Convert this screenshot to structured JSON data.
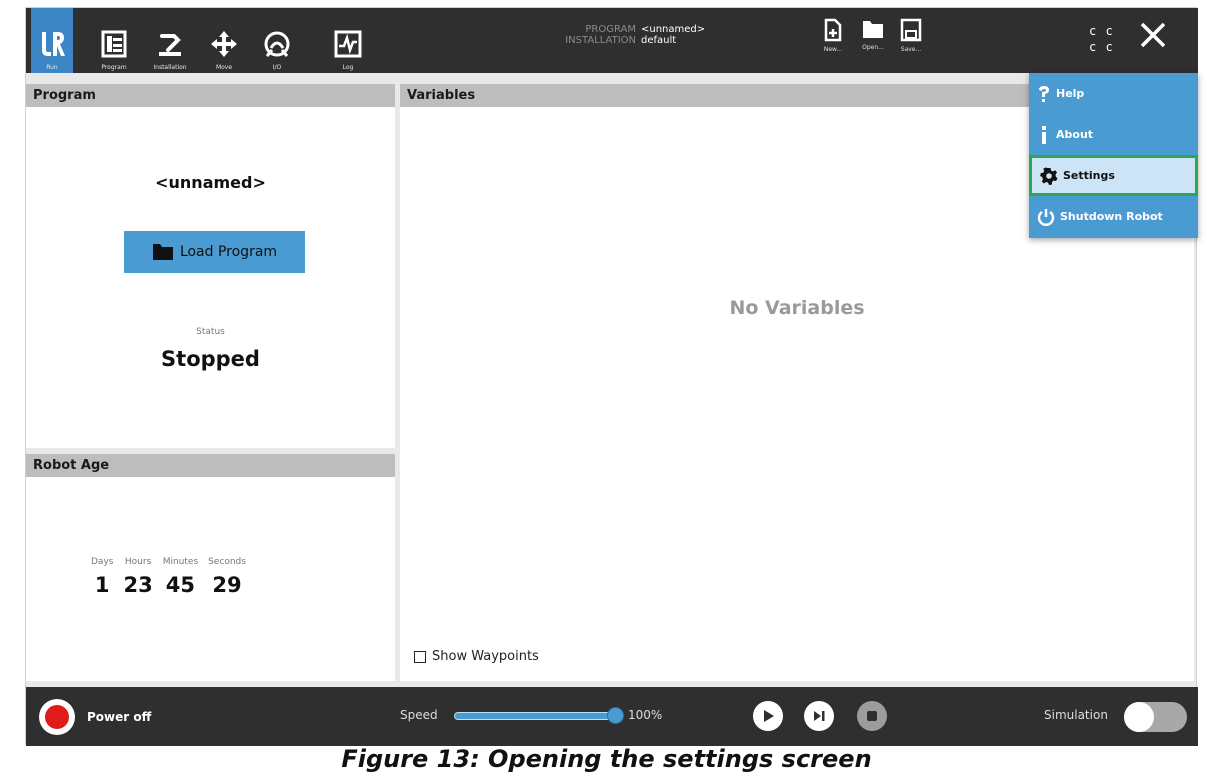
{
  "topbar": {
    "tabs": [
      {
        "label": "Run",
        "icon": "ur-logo-icon"
      },
      {
        "label": "Program",
        "icon": "program-tree-icon"
      },
      {
        "label": "Installation",
        "icon": "robot-arm-icon"
      },
      {
        "label": "Move",
        "icon": "move-arrows-icon"
      },
      {
        "label": "I/O",
        "icon": "io-gauge-icon"
      },
      {
        "label": "Log",
        "icon": "log-waveform-icon"
      }
    ],
    "program_label": "PROGRAM",
    "program_value": "<unnamed>",
    "installation_label": "INSTALLATION",
    "installation_value": "default",
    "new_label": "New...",
    "open_label": "Open...",
    "save_label": "Save...",
    "cc_indicator": [
      "c c",
      "c c"
    ]
  },
  "program_panel": {
    "title": "Program",
    "program_name": "<unnamed>",
    "load_button": "Load Program",
    "status_label": "Status",
    "status_value": "Stopped"
  },
  "robot_age": {
    "title": "Robot Age",
    "columns": [
      {
        "label": "Days",
        "value": "1"
      },
      {
        "label": "Hours",
        "value": "23"
      },
      {
        "label": "Minutes",
        "value": "45"
      },
      {
        "label": "Seconds",
        "value": "29"
      }
    ]
  },
  "variables_panel": {
    "title": "Variables",
    "empty_text": "No Variables",
    "show_waypoints": "Show Waypoints"
  },
  "menu": {
    "items": [
      {
        "label": "Help",
        "icon": "help-icon"
      },
      {
        "label": "About",
        "icon": "info-icon"
      },
      {
        "label": "Settings",
        "icon": "gear-icon",
        "highlighted": true
      },
      {
        "label": "Shutdown Robot",
        "icon": "power-icon"
      }
    ],
    "highlight_color": "#2aaa4f"
  },
  "bottombar": {
    "power_label": "Power off",
    "speed_label": "Speed",
    "speed_value": "100%",
    "speed_fraction": 1.0,
    "simulation_label": "Simulation",
    "simulation_on": false
  },
  "caption": "Figure 13: Opening the settings screen",
  "colors": {
    "accent": "#4a9bd2",
    "bar": "#2f2f2f",
    "power_off": "#e11b1b"
  }
}
